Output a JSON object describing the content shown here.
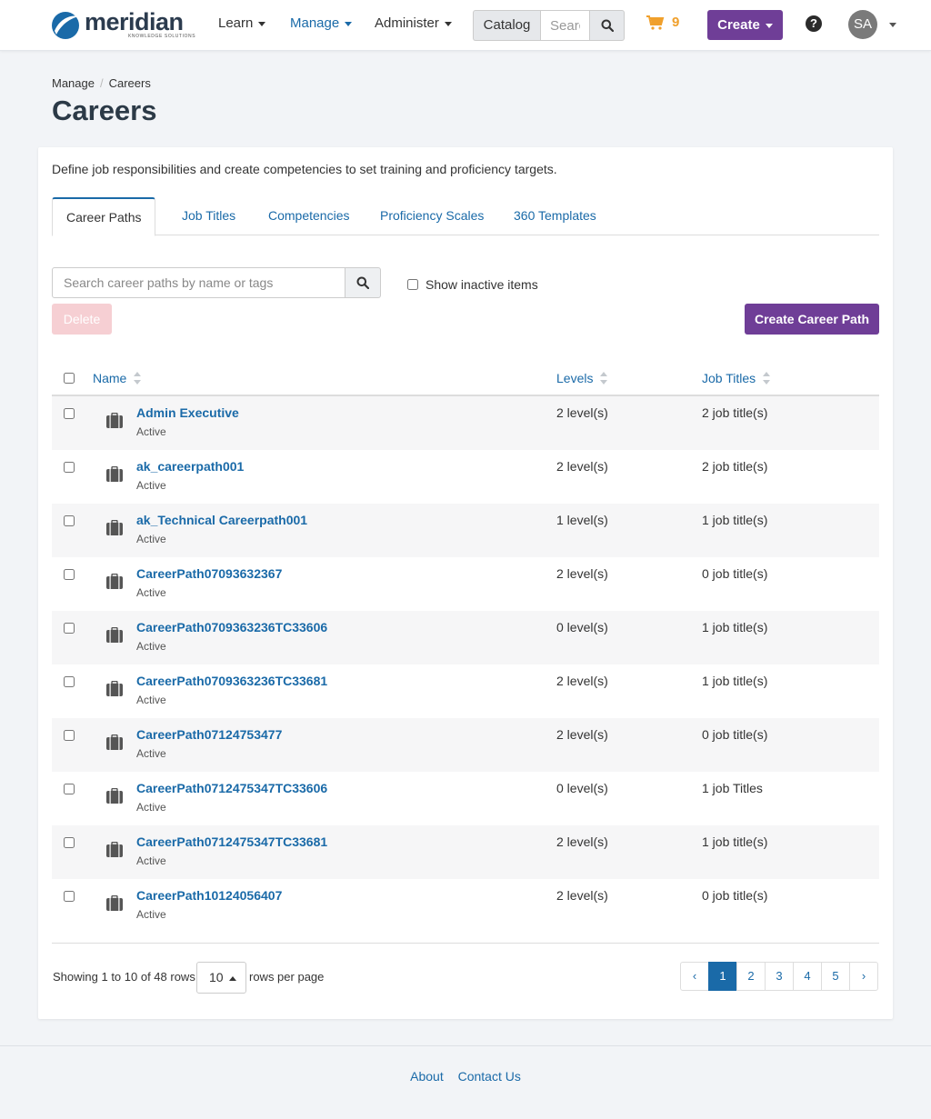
{
  "brand": {
    "name": "meridian",
    "tagline": "KNOWLEDGE SOLUTIONS",
    "accent": "#1a6aa8",
    "purple": "#6f3e97"
  },
  "nav": {
    "learn": "Learn",
    "manage": "Manage",
    "administer": "Administer",
    "catalog": "Catalog",
    "search_placeholder": "Search",
    "cart_count": "9",
    "create": "Create",
    "help": "?",
    "avatar_initials": "SA"
  },
  "breadcrumb": {
    "parent": "Manage",
    "current": "Careers"
  },
  "page_title": "Careers",
  "intro": "Define job responsibilities and create competencies to set training and proficiency targets.",
  "tabs": [
    {
      "label": "Career Paths",
      "active": true
    },
    {
      "label": "Job Titles"
    },
    {
      "label": "Competencies"
    },
    {
      "label": "Proficiency Scales"
    },
    {
      "label": "360 Templates"
    }
  ],
  "toolbar": {
    "search_placeholder": "Search career paths by name or tags",
    "show_inactive": "Show inactive items",
    "delete": "Delete",
    "create_path": "Create Career Path"
  },
  "table": {
    "columns": {
      "name": "Name",
      "levels": "Levels",
      "job_titles": "Job Titles"
    },
    "rows": [
      {
        "name": "Admin Executive",
        "status": "Active",
        "levels": "2 level(s)",
        "jobs": "2 job title(s)"
      },
      {
        "name": "ak_careerpath001",
        "status": "Active",
        "levels": "2 level(s)",
        "jobs": "2 job title(s)"
      },
      {
        "name": "ak_Technical Careerpath001",
        "status": "Active",
        "levels": "1 level(s)",
        "jobs": "1 job title(s)"
      },
      {
        "name": "CareerPath07093632367",
        "status": "Active",
        "levels": "2 level(s)",
        "jobs": "0 job title(s)"
      },
      {
        "name": "CareerPath0709363236TC33606",
        "status": "Active",
        "levels": "0 level(s)",
        "jobs": "1 job title(s)"
      },
      {
        "name": "CareerPath0709363236TC33681",
        "status": "Active",
        "levels": "2 level(s)",
        "jobs": "1 job title(s)"
      },
      {
        "name": "CareerPath07124753477",
        "status": "Active",
        "levels": "2 level(s)",
        "jobs": "0 job title(s)"
      },
      {
        "name": "CareerPath0712475347TC33606",
        "status": "Active",
        "levels": "0 level(s)",
        "jobs": "1 job Titles"
      },
      {
        "name": "CareerPath0712475347TC33681",
        "status": "Active",
        "levels": "2 level(s)",
        "jobs": "1 job title(s)"
      },
      {
        "name": "CareerPath10124056407",
        "status": "Active",
        "levels": "2 level(s)",
        "jobs": "0 job title(s)"
      }
    ]
  },
  "pagination": {
    "showing": "Showing 1 to 10 of 48 rows",
    "per_page": "10",
    "rows_per_page": "rows per page",
    "prev": "‹",
    "pages": [
      "1",
      "2",
      "3",
      "4",
      "5"
    ],
    "next": "›"
  },
  "footer": {
    "about": "About",
    "contact": "Contact Us"
  }
}
